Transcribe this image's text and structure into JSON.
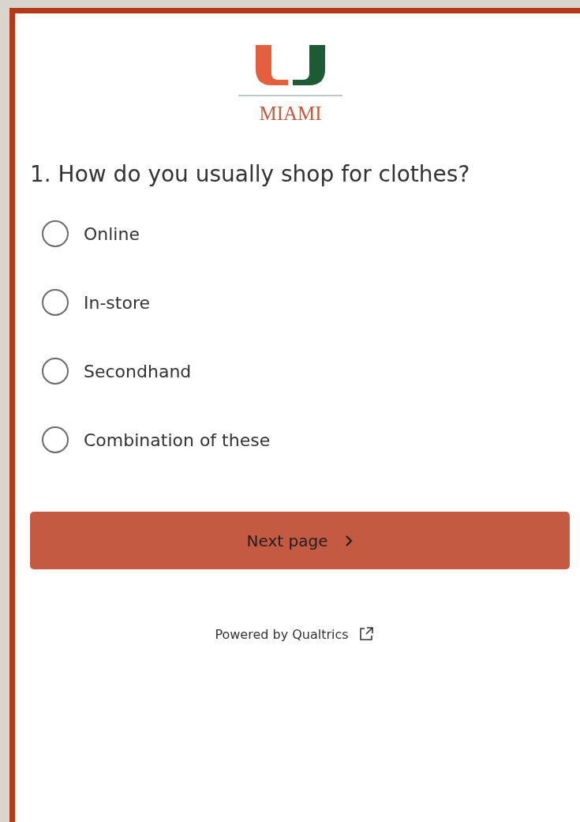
{
  "logo": {
    "wordmark": "MIAMI"
  },
  "question": {
    "text": "1. How do you usually shop for clothes?",
    "options": [
      {
        "label": "Online",
        "selected": false
      },
      {
        "label": "In-store",
        "selected": false
      },
      {
        "label": "Secondhand",
        "selected": false
      },
      {
        "label": "Combination of these",
        "selected": false
      }
    ]
  },
  "next_button": {
    "label": "Next page"
  },
  "footer": {
    "text": "Powered by Qualtrics"
  }
}
